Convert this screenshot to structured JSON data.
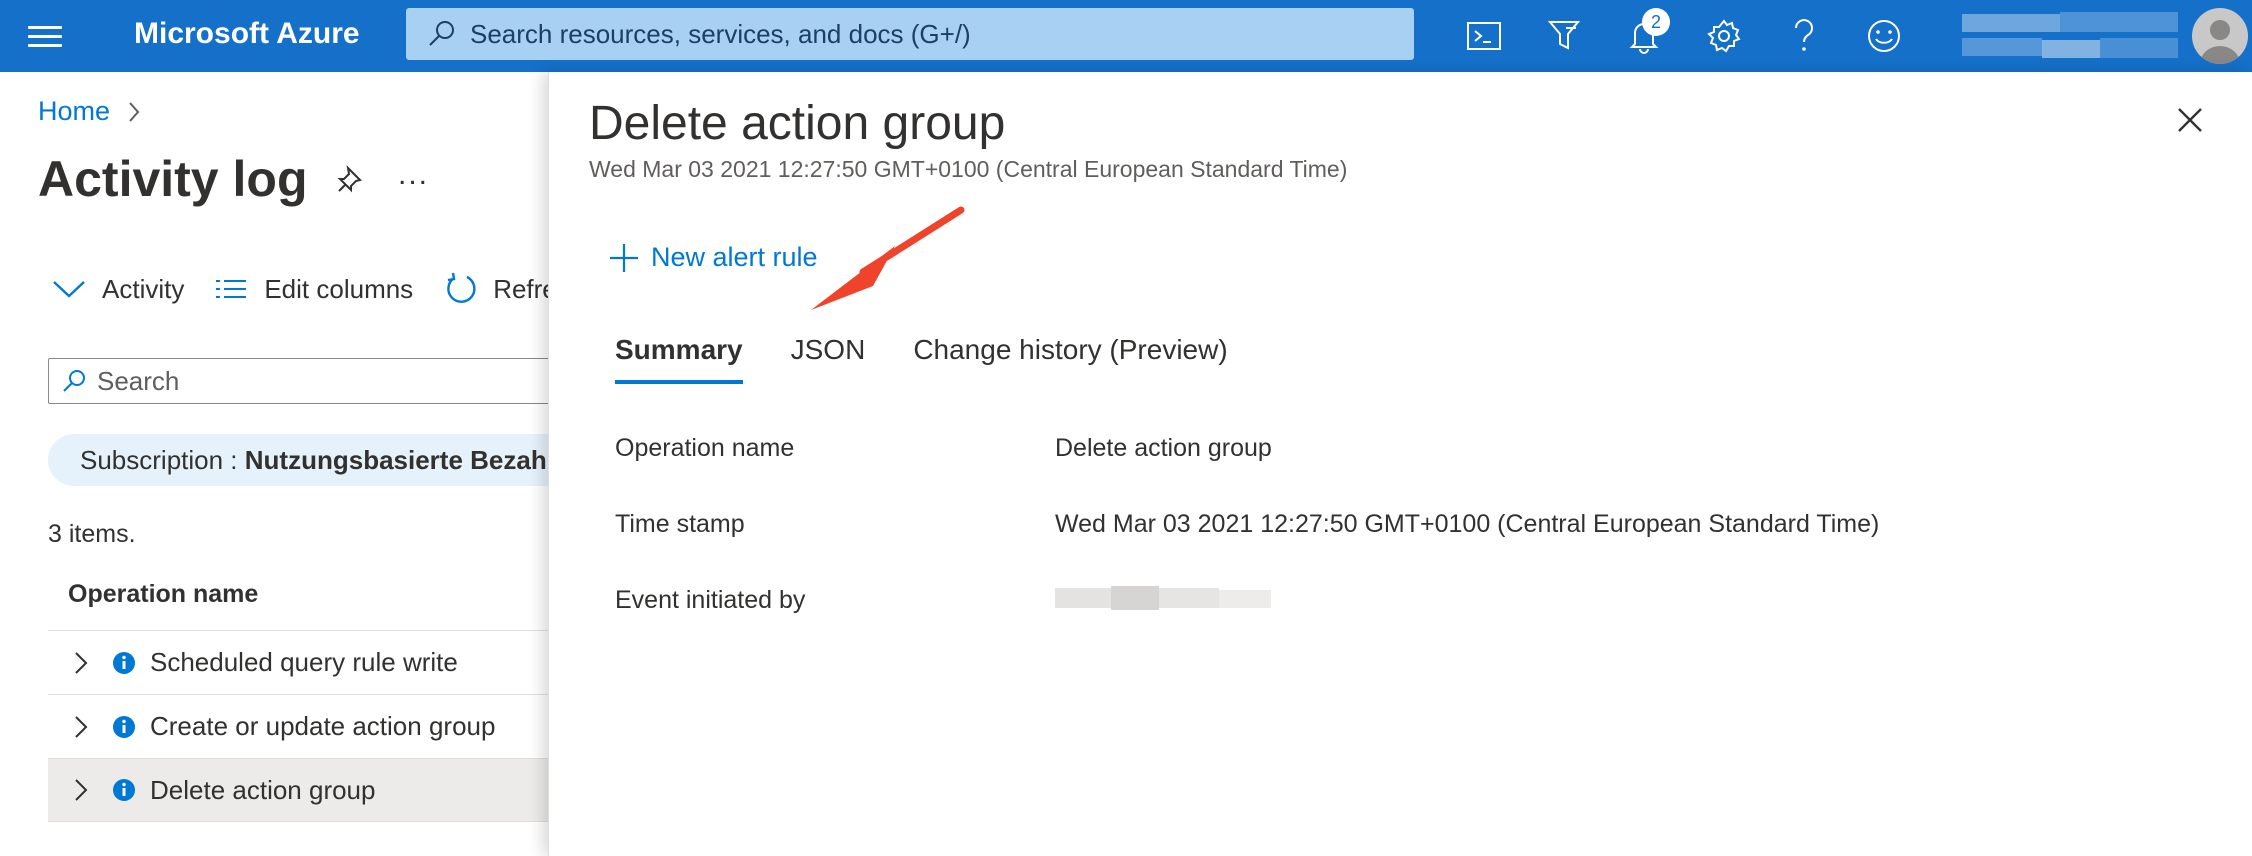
{
  "topbar": {
    "brand": "Microsoft Azure",
    "search_placeholder": "Search resources, services, and docs (G+/)",
    "notification_count": "2",
    "colors": {
      "bar": "#1570c9",
      "search_bg": "#a7d0f2"
    }
  },
  "left_blade": {
    "breadcrumb": "Home",
    "title": "Activity log",
    "more_label": "...",
    "commands": [
      {
        "label": "Activity",
        "icon": "chevron-down-icon"
      },
      {
        "label": "Edit columns",
        "icon": "columns-icon"
      },
      {
        "label": "Refre",
        "icon": "refresh-icon"
      }
    ],
    "search_placeholder": "Search",
    "filter_pill": {
      "key": "Subscription : ",
      "value": "Nutzungsbasierte Bezahl"
    },
    "item_count": "3 items.",
    "column_header": "Operation name",
    "rows": [
      {
        "label": "Scheduled query rule write",
        "selected": false
      },
      {
        "label": "Create or update action group",
        "selected": false
      },
      {
        "label": "Delete action group",
        "selected": true
      }
    ]
  },
  "detail_blade": {
    "title": "Delete action group",
    "subtitle": "Wed Mar 03 2021 12:27:50 GMT+0100 (Central European Standard Time)",
    "new_alert_rule": "New alert rule",
    "tabs": [
      {
        "label": "Summary",
        "active": true
      },
      {
        "label": "JSON",
        "active": false
      },
      {
        "label": "Change history (Preview)",
        "active": false
      }
    ],
    "properties": [
      {
        "key": "Operation name",
        "value": "Delete action group"
      },
      {
        "key": "Time stamp",
        "value": "Wed Mar 03 2021 12:27:50 GMT+0100 (Central European Standard Time)"
      },
      {
        "key": "Event initiated by",
        "value": ""
      }
    ],
    "annotation_color": "#f0432c"
  }
}
